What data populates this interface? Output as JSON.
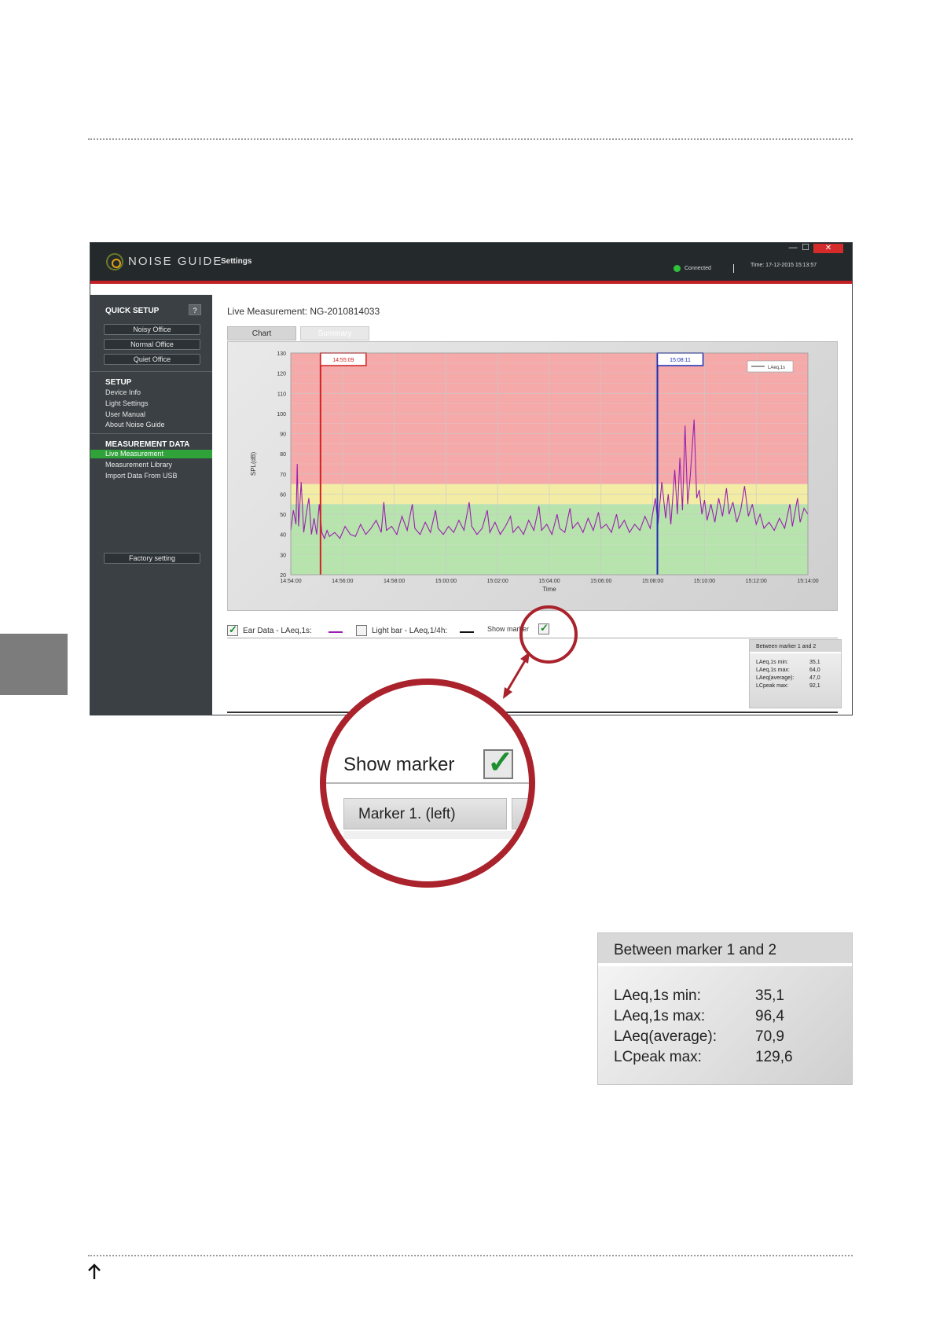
{
  "app": {
    "brand": "NOISE GUIDE",
    "separator": "·",
    "settings_label": "Settings",
    "status": "Connected",
    "time": "Time: 17-12-2015 15:13:57",
    "window_controls": {
      "minimize": "—",
      "maximize": "☐",
      "close": "✕"
    }
  },
  "sidebar": {
    "quick_setup": {
      "heading": "QUICK SETUP",
      "help": "?",
      "buttons": [
        "Noisy Office",
        "Normal Office",
        "Quiet Office"
      ]
    },
    "setup": {
      "heading": "SETUP",
      "items": [
        "Device Info",
        "Light Settings",
        "User Manual",
        "About Noise Guide"
      ]
    },
    "measurement_data": {
      "heading": "MEASUREMENT DATA",
      "items": [
        "Live Measurement",
        "Measurement Library",
        "Import Data From USB"
      ],
      "active_index": 0
    },
    "factory_button": "Factory setting"
  },
  "main": {
    "title": "Live Measurement: NG-2010814033",
    "tabs": [
      "Chart",
      "Summary"
    ],
    "active_tab": "Chart"
  },
  "legend": {
    "ear_data": {
      "label": "Ear Data - LAeq,1s:",
      "checked": true,
      "color": "#9b1fb0"
    },
    "light_bar": {
      "label": "Light bar - LAeq,1/4h:",
      "checked": false,
      "color": "#111111"
    },
    "show_marker": {
      "label": "Show marker",
      "checked": true
    }
  },
  "summary_box": {
    "title": "Between marker 1 and 2",
    "rows": [
      {
        "label": "LAeq,1s min:",
        "value": "35,1"
      },
      {
        "label": "LAeq,1s max:",
        "value": "64,0"
      },
      {
        "label": "LAeq(average):",
        "value": "47,0"
      },
      {
        "label": "LCpeak max:",
        "value": "92,1"
      }
    ]
  },
  "zoom": {
    "show_marker": "Show marker",
    "marker_label": "Marker 1. (left)"
  },
  "big_summary": {
    "title": "Between marker 1 and 2",
    "rows": [
      {
        "label": "LAeq,1s min:",
        "value": "35,1"
      },
      {
        "label": "LAeq,1s max:",
        "value": "96,4"
      },
      {
        "label": "LAeq(average):",
        "value": "70,9"
      },
      {
        "label": "LCpeak max:",
        "value": "129,6"
      }
    ]
  },
  "colors": {
    "accent_red": "#a9222c",
    "active_green": "#2fa23a",
    "titlebar": "#24292c",
    "sidebar": "#3a4044"
  },
  "chart_data": {
    "type": "line",
    "ylabel": "SPL(dB)",
    "xlabel": "Time",
    "ylim": [
      20,
      130
    ],
    "y_ticks": [
      20,
      30,
      40,
      50,
      60,
      70,
      80,
      90,
      100,
      110,
      120,
      130
    ],
    "x_ticks": [
      "14:54:00",
      "14:56:00",
      "14:58:00",
      "15:00:00",
      "15:02:00",
      "15:04:00",
      "15:06:00",
      "15:08:00",
      "15:10:00",
      "15:12:00",
      "15:14:00"
    ],
    "x_range_minutes": [
      0,
      20
    ],
    "zones": [
      {
        "from": 20,
        "to": 55,
        "color": "#b7e3ad"
      },
      {
        "from": 55,
        "to": 65,
        "color": "#f3eca4"
      },
      {
        "from": 65,
        "to": 130,
        "color": "#f5a9a9"
      }
    ],
    "legend": {
      "entry": "LAeq,1s",
      "position": "top-right"
    },
    "markers": [
      {
        "label": "14:55:09",
        "x_min": 1.15,
        "color": "#d42020"
      },
      {
        "label": "15:08:11",
        "x_min": 14.18,
        "color": "#1d2fb5"
      }
    ],
    "series": [
      {
        "name": "LAeq,1s",
        "color": "#9b1fb0",
        "points": [
          [
            0,
            42
          ],
          [
            0.1,
            52
          ],
          [
            0.2,
            45
          ],
          [
            0.25,
            75
          ],
          [
            0.3,
            44
          ],
          [
            0.4,
            66
          ],
          [
            0.5,
            41
          ],
          [
            0.6,
            50
          ],
          [
            0.7,
            58
          ],
          [
            0.8,
            40
          ],
          [
            0.9,
            48
          ],
          [
            1.0,
            40
          ],
          [
            1.1,
            55
          ],
          [
            1.2,
            41
          ],
          [
            1.3,
            38
          ],
          [
            1.4,
            42
          ],
          [
            1.5,
            39
          ],
          [
            1.7,
            41
          ],
          [
            1.9,
            38
          ],
          [
            2.1,
            44
          ],
          [
            2.3,
            40
          ],
          [
            2.5,
            39
          ],
          [
            2.7,
            45
          ],
          [
            2.9,
            40
          ],
          [
            3.1,
            43
          ],
          [
            3.3,
            47
          ],
          [
            3.5,
            41
          ],
          [
            3.6,
            56
          ],
          [
            3.7,
            42
          ],
          [
            3.9,
            44
          ],
          [
            4.1,
            40
          ],
          [
            4.3,
            49
          ],
          [
            4.5,
            42
          ],
          [
            4.7,
            55
          ],
          [
            4.8,
            43
          ],
          [
            5.0,
            40
          ],
          [
            5.2,
            46
          ],
          [
            5.4,
            41
          ],
          [
            5.6,
            52
          ],
          [
            5.7,
            43
          ],
          [
            5.9,
            40
          ],
          [
            6.1,
            44
          ],
          [
            6.3,
            41
          ],
          [
            6.5,
            47
          ],
          [
            6.7,
            42
          ],
          [
            6.9,
            56
          ],
          [
            7.0,
            44
          ],
          [
            7.2,
            40
          ],
          [
            7.4,
            43
          ],
          [
            7.6,
            52
          ],
          [
            7.7,
            41
          ],
          [
            7.9,
            46
          ],
          [
            8.1,
            40
          ],
          [
            8.3,
            44
          ],
          [
            8.5,
            49
          ],
          [
            8.6,
            41
          ],
          [
            8.8,
            44
          ],
          [
            9.0,
            40
          ],
          [
            9.2,
            47
          ],
          [
            9.4,
            42
          ],
          [
            9.6,
            54
          ],
          [
            9.7,
            42
          ],
          [
            9.9,
            45
          ],
          [
            10.1,
            40
          ],
          [
            10.3,
            50
          ],
          [
            10.4,
            43
          ],
          [
            10.6,
            41
          ],
          [
            10.8,
            53
          ],
          [
            10.9,
            43
          ],
          [
            11.1,
            46
          ],
          [
            11.3,
            41
          ],
          [
            11.5,
            48
          ],
          [
            11.7,
            42
          ],
          [
            11.9,
            51
          ],
          [
            12.0,
            43
          ],
          [
            12.2,
            45
          ],
          [
            12.4,
            41
          ],
          [
            12.6,
            50
          ],
          [
            12.7,
            43
          ],
          [
            12.9,
            47
          ],
          [
            13.1,
            41
          ],
          [
            13.3,
            45
          ],
          [
            13.5,
            42
          ],
          [
            13.7,
            49
          ],
          [
            13.9,
            43
          ],
          [
            14.1,
            58
          ],
          [
            14.2,
            45
          ],
          [
            14.35,
            66
          ],
          [
            14.5,
            48
          ],
          [
            14.6,
            60
          ],
          [
            14.7,
            45
          ],
          [
            14.85,
            72
          ],
          [
            14.95,
            50
          ],
          [
            15.05,
            78
          ],
          [
            15.15,
            52
          ],
          [
            15.25,
            94
          ],
          [
            15.35,
            55
          ],
          [
            15.45,
            69
          ],
          [
            15.6,
            97
          ],
          [
            15.7,
            58
          ],
          [
            15.8,
            62
          ],
          [
            15.9,
            50
          ],
          [
            16.0,
            57
          ],
          [
            16.1,
            47
          ],
          [
            16.25,
            55
          ],
          [
            16.4,
            46
          ],
          [
            16.55,
            58
          ],
          [
            16.7,
            49
          ],
          [
            16.85,
            63
          ],
          [
            16.95,
            50
          ],
          [
            17.1,
            56
          ],
          [
            17.25,
            46
          ],
          [
            17.4,
            52
          ],
          [
            17.55,
            64
          ],
          [
            17.7,
            49
          ],
          [
            17.85,
            55
          ],
          [
            18.0,
            45
          ],
          [
            18.15,
            50
          ],
          [
            18.3,
            43
          ],
          [
            18.5,
            46
          ],
          [
            18.7,
            42
          ],
          [
            18.9,
            48
          ],
          [
            19.1,
            43
          ],
          [
            19.3,
            55
          ],
          [
            19.4,
            44
          ],
          [
            19.6,
            58
          ],
          [
            19.7,
            46
          ],
          [
            19.85,
            53
          ],
          [
            20.0,
            50
          ]
        ]
      }
    ]
  }
}
